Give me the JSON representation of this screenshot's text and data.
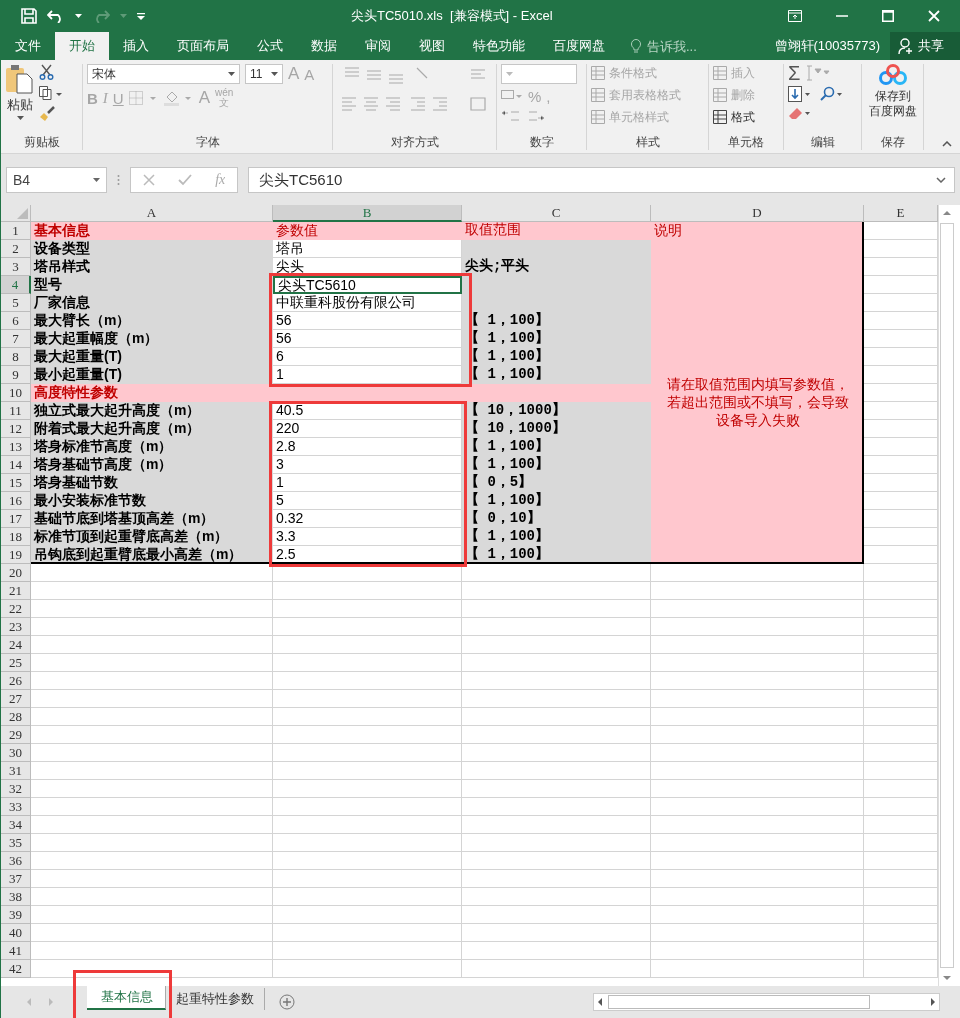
{
  "window": {
    "title": "尖头TC5010.xls  [兼容模式] - Excel"
  },
  "menu_tabs": [
    {
      "label": "文件",
      "selected": false
    },
    {
      "label": "开始",
      "selected": true
    },
    {
      "label": "插入",
      "selected": false
    },
    {
      "label": "页面布局",
      "selected": false
    },
    {
      "label": "公式",
      "selected": false
    },
    {
      "label": "数据",
      "selected": false
    },
    {
      "label": "审阅",
      "selected": false
    },
    {
      "label": "视图",
      "selected": false
    },
    {
      "label": "特色功能",
      "selected": false
    },
    {
      "label": "百度网盘",
      "selected": false
    }
  ],
  "tell_me": {
    "placeholder": "告诉我..."
  },
  "account": {
    "user": "曾翊轩(10035773)",
    "share": "共享"
  },
  "ribbon": {
    "clipboard": {
      "paste": "粘贴",
      "label": "剪贴板"
    },
    "font": {
      "name": "宋体",
      "size": "11",
      "grow": "A",
      "shrink": "A",
      "bold": "B",
      "italic": "I",
      "underline": "U",
      "font_color": "A",
      "phonetic": [
        "wén",
        "文"
      ],
      "label": "字体"
    },
    "alignment": {
      "label": "对齐方式"
    },
    "number": {
      "percent": "%",
      "comma": ",",
      "label": "数字"
    },
    "styles": {
      "items": [
        "条件格式",
        "套用表格格式",
        "单元格样式"
      ],
      "label": "样式"
    },
    "cells": {
      "items": [
        {
          "label": "插入",
          "disabled": true
        },
        {
          "label": "删除",
          "disabled": true
        },
        {
          "label": "格式",
          "disabled": false
        }
      ],
      "label": "单元格"
    },
    "editing": {
      "sum": "Σ",
      "label": "编辑"
    },
    "save": {
      "lines": [
        "保存到",
        "百度网盘"
      ],
      "label": "保存"
    }
  },
  "formula_bar": {
    "name_box": "B4",
    "function_label": "fx",
    "value": "尖头TC5610"
  },
  "sheet": {
    "columns": [
      {
        "label": "A",
        "selected": false
      },
      {
        "label": "B",
        "selected": true
      },
      {
        "label": "C",
        "selected": false
      },
      {
        "label": "D",
        "selected": false
      },
      {
        "label": "E",
        "selected": false
      }
    ],
    "rows": [
      {
        "number": "1",
        "kind": "section",
        "selected": false,
        "a": "基本信息",
        "b": "参数值",
        "c": "取值范围",
        "d": "说明"
      },
      {
        "number": "2",
        "kind": "data",
        "selected": false,
        "a": "设备类型",
        "b": "塔吊"
      },
      {
        "number": "3",
        "kind": "data",
        "selected": false,
        "a": "塔吊样式",
        "b": "尖头",
        "c": "尖头;平头"
      },
      {
        "number": "4",
        "kind": "data",
        "selected": true,
        "a": "型号",
        "b": "尖头TC5610"
      },
      {
        "number": "5",
        "kind": "data",
        "selected": false,
        "a": "厂家信息",
        "b": "中联重科股份有限公司"
      },
      {
        "number": "6",
        "kind": "data",
        "selected": false,
        "a": "最大臂长（m）",
        "b": "56",
        "c": "【 1，100】"
      },
      {
        "number": "7",
        "kind": "data",
        "selected": false,
        "a": "最大起重幅度（m）",
        "b": "56",
        "c": "【 1，100】"
      },
      {
        "number": "8",
        "kind": "data",
        "selected": false,
        "a": "最大起重量(T)",
        "b": "6",
        "c": "【 1，100】"
      },
      {
        "number": "9",
        "kind": "data",
        "selected": false,
        "a": "最小起重量(T)",
        "b": "1",
        "c": "【 1，100】"
      },
      {
        "number": "10",
        "kind": "section",
        "selected": false,
        "a": "高度特性参数"
      },
      {
        "number": "11",
        "kind": "data",
        "selected": false,
        "a": "独立式最大起升高度（m）",
        "b": "40.5",
        "c": "【 10，1000】"
      },
      {
        "number": "12",
        "kind": "data",
        "selected": false,
        "a": "附着式最大起升高度（m）",
        "b": "220",
        "c": "【 10，1000】"
      },
      {
        "number": "13",
        "kind": "data",
        "selected": false,
        "a": "塔身标准节高度（m）",
        "b": "2.8",
        "c": "【 1，100】"
      },
      {
        "number": "14",
        "kind": "data",
        "selected": false,
        "a": "塔身基础节高度（m）",
        "b": "3",
        "c": "【 1，100】"
      },
      {
        "number": "15",
        "kind": "data",
        "selected": false,
        "a": "塔身基础节数",
        "b": "1",
        "c": "【 0，5】"
      },
      {
        "number": "16",
        "kind": "data",
        "selected": false,
        "a": "最小安装标准节数",
        "b": "5",
        "c": "【 1，100】"
      },
      {
        "number": "17",
        "kind": "data",
        "selected": false,
        "a": "基础节底到塔基顶高差（m）",
        "b": "0.32",
        "c": "【 0，10】"
      },
      {
        "number": "18",
        "kind": "data",
        "selected": false,
        "a": "标准节顶到起重臂底高差（m）",
        "b": "3.3",
        "c": "【 1，100】"
      },
      {
        "number": "19",
        "kind": "data",
        "selected": false,
        "a": "吊钩底到起重臂底最小高差（m）",
        "b": "2.5",
        "c": "【 1，100】"
      }
    ],
    "note": "请在取值范围内填写参数值，若超出范围或不填写，会导致设备导入失败",
    "empty_rows": [
      "20",
      "21",
      "22",
      "23",
      "24",
      "25",
      "26",
      "27",
      "28",
      "29",
      "30",
      "31",
      "32",
      "33",
      "34",
      "35",
      "36",
      "37",
      "38",
      "39",
      "40",
      "41",
      "42"
    ]
  },
  "sheet_tabs": [
    {
      "label": "基本信息",
      "selected": true
    },
    {
      "label": "起重特性参数",
      "selected": false
    }
  ]
}
